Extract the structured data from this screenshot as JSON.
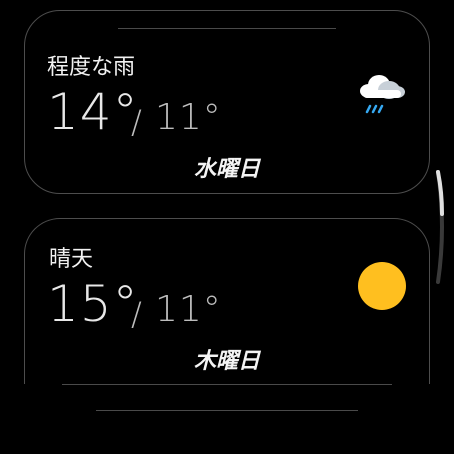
{
  "cards": [
    {
      "description": "程度な雨",
      "high": "14°",
      "separator": "/",
      "low": "11°",
      "day": "水曜日",
      "icon": "rain-cloud-icon"
    },
    {
      "description": "晴天",
      "high": "15°",
      "separator": "/",
      "low": "11°",
      "day": "木曜日",
      "icon": "sun-icon"
    }
  ],
  "colors": {
    "background": "#000000",
    "sun": "#FFBF1F",
    "rain": "#36A9F2",
    "card_border": "#4D4D4D"
  }
}
